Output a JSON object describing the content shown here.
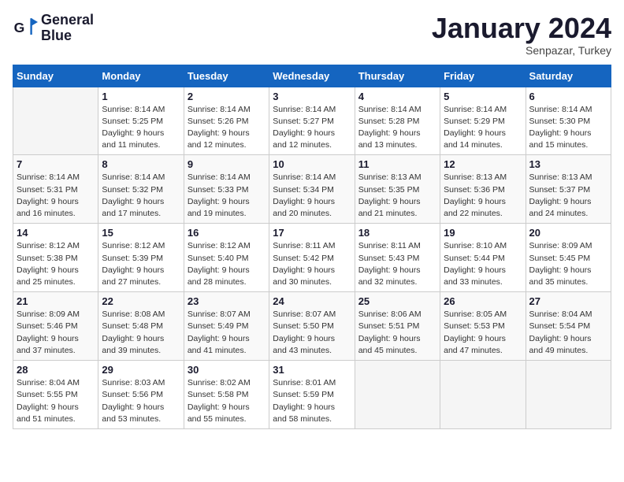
{
  "header": {
    "logo_line1": "General",
    "logo_line2": "Blue",
    "title": "January 2024",
    "subtitle": "Senpazar, Turkey"
  },
  "weekdays": [
    "Sunday",
    "Monday",
    "Tuesday",
    "Wednesday",
    "Thursday",
    "Friday",
    "Saturday"
  ],
  "weeks": [
    [
      {
        "day": "",
        "info": ""
      },
      {
        "day": "1",
        "info": "Sunrise: 8:14 AM\nSunset: 5:25 PM\nDaylight: 9 hours\nand 11 minutes."
      },
      {
        "day": "2",
        "info": "Sunrise: 8:14 AM\nSunset: 5:26 PM\nDaylight: 9 hours\nand 12 minutes."
      },
      {
        "day": "3",
        "info": "Sunrise: 8:14 AM\nSunset: 5:27 PM\nDaylight: 9 hours\nand 12 minutes."
      },
      {
        "day": "4",
        "info": "Sunrise: 8:14 AM\nSunset: 5:28 PM\nDaylight: 9 hours\nand 13 minutes."
      },
      {
        "day": "5",
        "info": "Sunrise: 8:14 AM\nSunset: 5:29 PM\nDaylight: 9 hours\nand 14 minutes."
      },
      {
        "day": "6",
        "info": "Sunrise: 8:14 AM\nSunset: 5:30 PM\nDaylight: 9 hours\nand 15 minutes."
      }
    ],
    [
      {
        "day": "7",
        "info": "Sunrise: 8:14 AM\nSunset: 5:31 PM\nDaylight: 9 hours\nand 16 minutes."
      },
      {
        "day": "8",
        "info": "Sunrise: 8:14 AM\nSunset: 5:32 PM\nDaylight: 9 hours\nand 17 minutes."
      },
      {
        "day": "9",
        "info": "Sunrise: 8:14 AM\nSunset: 5:33 PM\nDaylight: 9 hours\nand 19 minutes."
      },
      {
        "day": "10",
        "info": "Sunrise: 8:14 AM\nSunset: 5:34 PM\nDaylight: 9 hours\nand 20 minutes."
      },
      {
        "day": "11",
        "info": "Sunrise: 8:13 AM\nSunset: 5:35 PM\nDaylight: 9 hours\nand 21 minutes."
      },
      {
        "day": "12",
        "info": "Sunrise: 8:13 AM\nSunset: 5:36 PM\nDaylight: 9 hours\nand 22 minutes."
      },
      {
        "day": "13",
        "info": "Sunrise: 8:13 AM\nSunset: 5:37 PM\nDaylight: 9 hours\nand 24 minutes."
      }
    ],
    [
      {
        "day": "14",
        "info": "Sunrise: 8:12 AM\nSunset: 5:38 PM\nDaylight: 9 hours\nand 25 minutes."
      },
      {
        "day": "15",
        "info": "Sunrise: 8:12 AM\nSunset: 5:39 PM\nDaylight: 9 hours\nand 27 minutes."
      },
      {
        "day": "16",
        "info": "Sunrise: 8:12 AM\nSunset: 5:40 PM\nDaylight: 9 hours\nand 28 minutes."
      },
      {
        "day": "17",
        "info": "Sunrise: 8:11 AM\nSunset: 5:42 PM\nDaylight: 9 hours\nand 30 minutes."
      },
      {
        "day": "18",
        "info": "Sunrise: 8:11 AM\nSunset: 5:43 PM\nDaylight: 9 hours\nand 32 minutes."
      },
      {
        "day": "19",
        "info": "Sunrise: 8:10 AM\nSunset: 5:44 PM\nDaylight: 9 hours\nand 33 minutes."
      },
      {
        "day": "20",
        "info": "Sunrise: 8:09 AM\nSunset: 5:45 PM\nDaylight: 9 hours\nand 35 minutes."
      }
    ],
    [
      {
        "day": "21",
        "info": "Sunrise: 8:09 AM\nSunset: 5:46 PM\nDaylight: 9 hours\nand 37 minutes."
      },
      {
        "day": "22",
        "info": "Sunrise: 8:08 AM\nSunset: 5:48 PM\nDaylight: 9 hours\nand 39 minutes."
      },
      {
        "day": "23",
        "info": "Sunrise: 8:07 AM\nSunset: 5:49 PM\nDaylight: 9 hours\nand 41 minutes."
      },
      {
        "day": "24",
        "info": "Sunrise: 8:07 AM\nSunset: 5:50 PM\nDaylight: 9 hours\nand 43 minutes."
      },
      {
        "day": "25",
        "info": "Sunrise: 8:06 AM\nSunset: 5:51 PM\nDaylight: 9 hours\nand 45 minutes."
      },
      {
        "day": "26",
        "info": "Sunrise: 8:05 AM\nSunset: 5:53 PM\nDaylight: 9 hours\nand 47 minutes."
      },
      {
        "day": "27",
        "info": "Sunrise: 8:04 AM\nSunset: 5:54 PM\nDaylight: 9 hours\nand 49 minutes."
      }
    ],
    [
      {
        "day": "28",
        "info": "Sunrise: 8:04 AM\nSunset: 5:55 PM\nDaylight: 9 hours\nand 51 minutes."
      },
      {
        "day": "29",
        "info": "Sunrise: 8:03 AM\nSunset: 5:56 PM\nDaylight: 9 hours\nand 53 minutes."
      },
      {
        "day": "30",
        "info": "Sunrise: 8:02 AM\nSunset: 5:58 PM\nDaylight: 9 hours\nand 55 minutes."
      },
      {
        "day": "31",
        "info": "Sunrise: 8:01 AM\nSunset: 5:59 PM\nDaylight: 9 hours\nand 58 minutes."
      },
      {
        "day": "",
        "info": ""
      },
      {
        "day": "",
        "info": ""
      },
      {
        "day": "",
        "info": ""
      }
    ]
  ]
}
